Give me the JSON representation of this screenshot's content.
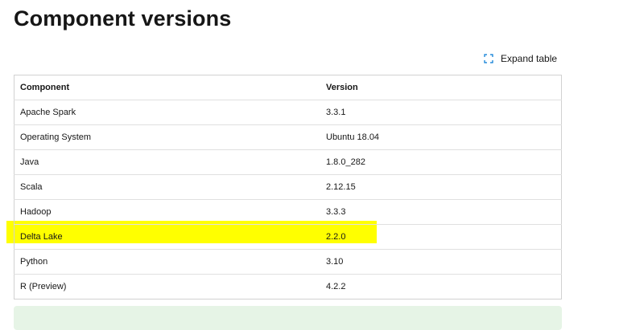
{
  "page": {
    "title": "Component versions"
  },
  "toolbar": {
    "expand_label": "Expand table",
    "expand_icon": "expand-icon"
  },
  "table": {
    "headers": [
      "Component",
      "Version"
    ],
    "rows": [
      {
        "component": "Apache Spark",
        "version": "3.3.1"
      },
      {
        "component": "Operating System",
        "version": "Ubuntu 18.04"
      },
      {
        "component": "Java",
        "version": "1.8.0_282"
      },
      {
        "component": "Scala",
        "version": "2.12.15"
      },
      {
        "component": "Hadoop",
        "version": "3.3.3"
      },
      {
        "component": "Delta Lake",
        "version": "2.2.0",
        "highlighted": true
      },
      {
        "component": "Python",
        "version": "3.10"
      },
      {
        "component": "R (Preview)",
        "version": "4.2.2"
      }
    ]
  },
  "colors": {
    "highlight": "#ffff00",
    "note_background": "#e6f4e6",
    "icon": "#0078d4"
  }
}
